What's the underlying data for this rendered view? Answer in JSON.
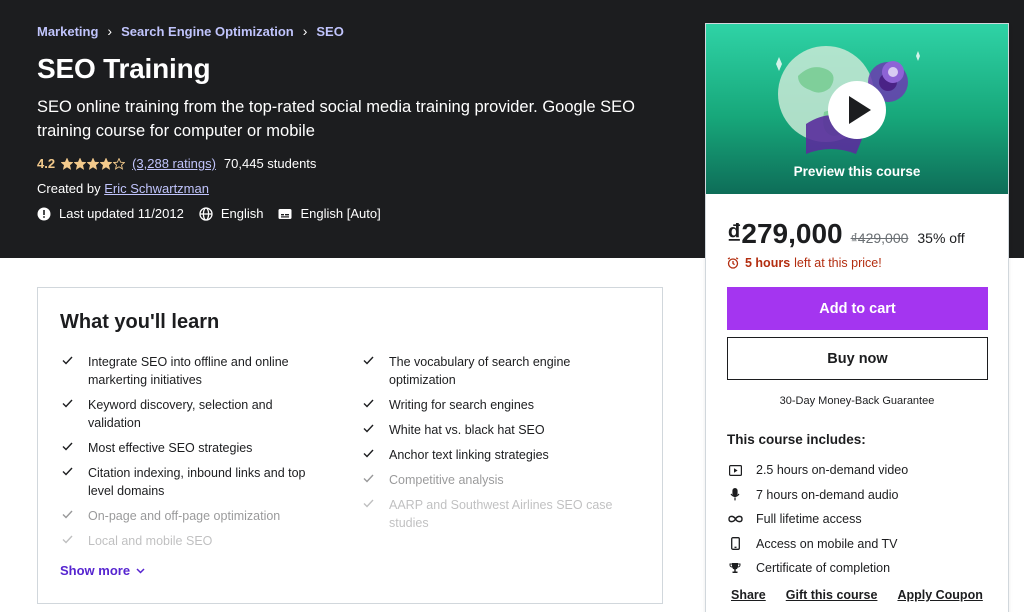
{
  "breadcrumb": [
    "Marketing",
    "Search Engine Optimization",
    "SEO"
  ],
  "course": {
    "title": "SEO Training",
    "subtitle": "SEO online training from the top-rated social media training provider. Google SEO training course for computer or mobile",
    "rating": "4.2",
    "rating_value": 4.2,
    "ratings_count": "(3,288 ratings)",
    "students": "70,445 students",
    "created_by_label": "Created by",
    "instructor": "Eric Schwartzman",
    "last_updated": "Last updated 11/2012",
    "language": "English",
    "captions": "English [Auto]"
  },
  "sidebar": {
    "preview_label": "Preview this course",
    "price": "₫279,000",
    "original_price": "₫429,000",
    "discount": "35% off",
    "timer_hours": "5 hours",
    "timer_text": "left at this price!",
    "add_to_cart": "Add to cart",
    "buy_now": "Buy now",
    "guarantee": "30-Day Money-Back Guarantee",
    "includes_title": "This course includes:",
    "includes": [
      {
        "icon": "video-icon",
        "label": "2.5 hours on-demand video"
      },
      {
        "icon": "microphone-icon",
        "label": "7 hours on-demand audio"
      },
      {
        "icon": "infinity-icon",
        "label": "Full lifetime access"
      },
      {
        "icon": "mobile-icon",
        "label": "Access on mobile and TV"
      },
      {
        "icon": "trophy-icon",
        "label": "Certificate of completion"
      }
    ],
    "links": [
      "Share",
      "Gift this course",
      "Apply Coupon"
    ]
  },
  "learn": {
    "title": "What you'll learn",
    "left": [
      "Integrate SEO into offline and online markerting initiatives",
      "Keyword discovery, selection and validation",
      "Most effective SEO strategies",
      "Citation indexing, inbound links and top level domains",
      "On-page and off-page optimization",
      "Local and mobile SEO"
    ],
    "right": [
      "The vocabulary of search engine optimization",
      "Writing for search engines",
      "White hat vs. black hat SEO",
      "Anchor text linking strategies",
      "Competitive analysis",
      "AARP and Southwest Airlines SEO case studies"
    ],
    "show_more": "Show more"
  },
  "colors": {
    "header_bg": "#1c1d1f",
    "accent_purple": "#a435f0",
    "link_purple": "#5624d0",
    "star": "#f3ca8c",
    "timer_red": "#b32d0f"
  }
}
